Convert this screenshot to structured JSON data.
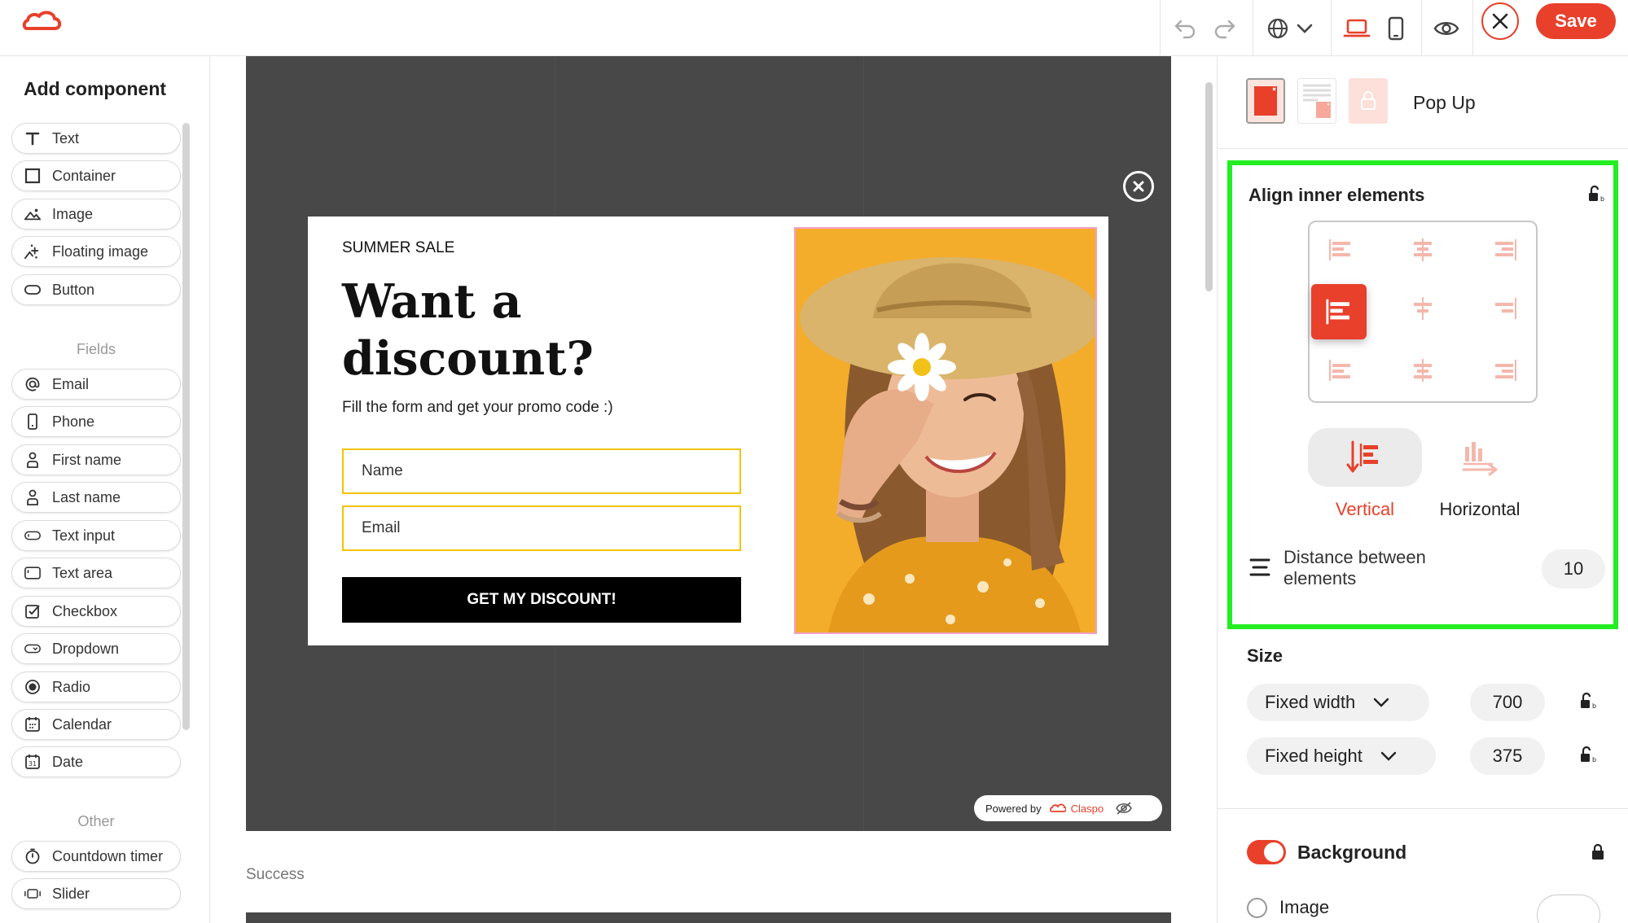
{
  "toolbar": {
    "logo_icon": "claspo-cloud-icon",
    "save_label": "Save",
    "accent": "#e8402b"
  },
  "left": {
    "title": "Add component",
    "components": [
      {
        "label": "Text",
        "icon": "text-icon"
      },
      {
        "label": "Container",
        "icon": "square-icon"
      },
      {
        "label": "Image",
        "icon": "image-icon"
      },
      {
        "label": "Floating image",
        "icon": "floating-image-icon"
      },
      {
        "label": "Button",
        "icon": "button-icon"
      }
    ],
    "fields_label": "Fields",
    "fields": [
      {
        "label": "Email",
        "icon": "at-icon"
      },
      {
        "label": "Phone",
        "icon": "phone-icon"
      },
      {
        "label": "First name",
        "icon": "person-icon"
      },
      {
        "label": "Last name",
        "icon": "person-icon"
      },
      {
        "label": "Text input",
        "icon": "text-input-icon"
      },
      {
        "label": "Text area",
        "icon": "text-area-icon"
      },
      {
        "label": "Checkbox",
        "icon": "checkbox-icon"
      },
      {
        "label": "Dropdown",
        "icon": "dropdown-icon"
      },
      {
        "label": "Radio",
        "icon": "radio-icon"
      },
      {
        "label": "Calendar",
        "icon": "calendar-icon"
      },
      {
        "label": "Date",
        "icon": "date-icon"
      }
    ],
    "other_label": "Other",
    "other": [
      {
        "label": "Countdown timer",
        "icon": "timer-icon"
      },
      {
        "label": "Slider",
        "icon": "slider-icon"
      }
    ]
  },
  "popup": {
    "kicker": "SUMMER SALE",
    "title": "Want a discount?",
    "subtitle": "Fill the form and get your promo code :)",
    "name_placeholder": "Name",
    "email_placeholder": "Email",
    "cta": "GET MY DISCOUNT!",
    "input_border": "#f3c300",
    "photo_bg": "#f3a724"
  },
  "canvas": {
    "powered_by": "Powered by",
    "brand": "Claspo",
    "success_label": "Success"
  },
  "right": {
    "layout_title": "Pop Up",
    "align": {
      "title": "Align inner elements",
      "direction_vertical": "Vertical",
      "direction_horizontal": "Horizontal",
      "distance_label": "Distance between elements",
      "distance_value": "10",
      "highlight_color": "#22ee22"
    },
    "size": {
      "title": "Size",
      "width_mode": "Fixed width",
      "width_value": "700",
      "height_mode": "Fixed height",
      "height_value": "375"
    },
    "background": {
      "title": "Background",
      "option_image": "Image"
    }
  }
}
